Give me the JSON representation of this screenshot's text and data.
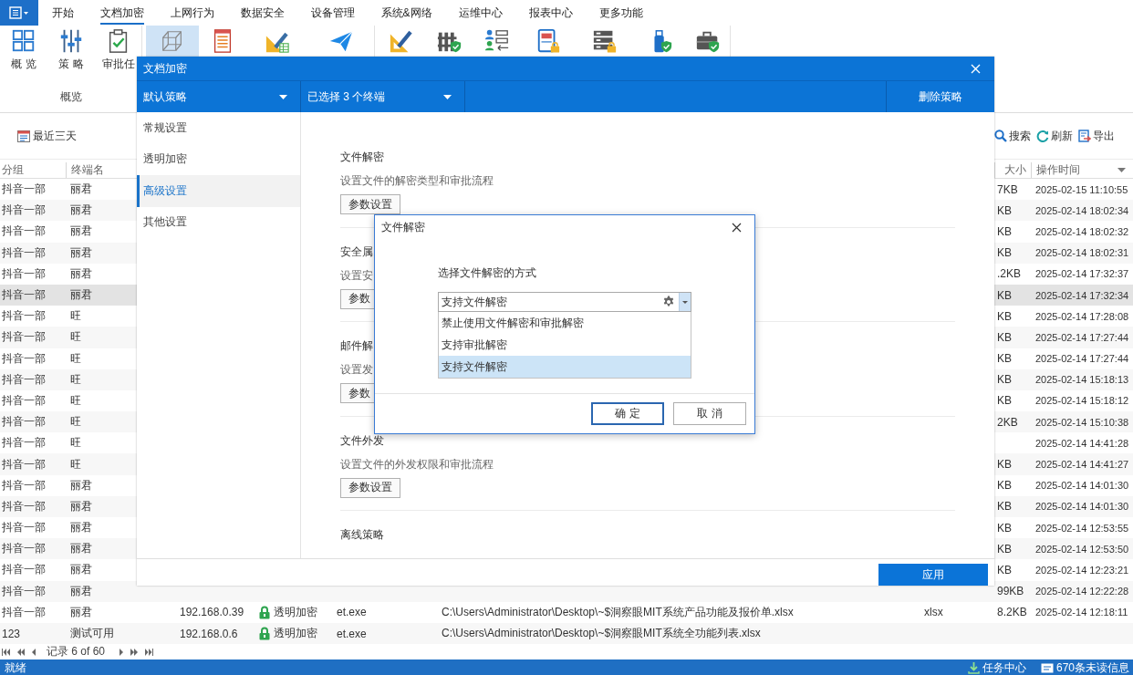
{
  "menu_tabs": [
    {
      "label": "开始",
      "selected": false
    },
    {
      "label": "文档加密",
      "selected": true
    },
    {
      "label": "上网行为",
      "selected": false
    },
    {
      "label": "数据安全",
      "selected": false
    },
    {
      "label": "设备管理",
      "selected": false
    },
    {
      "label": "系统&网络",
      "selected": false
    },
    {
      "label": "运维中心",
      "selected": false
    },
    {
      "label": "报表中心",
      "selected": false
    },
    {
      "label": "更多功能",
      "selected": false
    }
  ],
  "ribbon": {
    "groups": [
      {
        "label": "概览",
        "tools": [
          {
            "label": "概 览",
            "selected": false
          },
          {
            "label": "策 略",
            "selected": false
          },
          {
            "label": "审批任",
            "selected": false
          }
        ]
      },
      {
        "tools": [
          {
            "selected": true
          },
          {
            "selected": false
          },
          {
            "selected": false
          },
          {
            "selected": false
          }
        ]
      },
      {
        "tools": [
          {
            "selected": false
          },
          {
            "selected": false
          },
          {
            "selected": false
          },
          {
            "selected": false
          },
          {
            "selected": false
          },
          {
            "selected": false
          },
          {
            "selected": false
          }
        ]
      }
    ]
  },
  "filter": {
    "label": "最近三天"
  },
  "actions": [
    {
      "label": "搜索"
    },
    {
      "label": "刷新"
    },
    {
      "label": "导出"
    }
  ],
  "table": {
    "header": {
      "group": "分组",
      "terminal": "终端名",
      "size": "大小",
      "time": "操作时间"
    },
    "rows": [
      {
        "group": "抖音一部",
        "terminal": "丽君",
        "size": "7KB",
        "time": "2025-02-15 11:10:55",
        "selected": false
      },
      {
        "group": "抖音一部",
        "terminal": "丽君",
        "size": "KB",
        "time": "2025-02-14 18:02:34",
        "selected": false
      },
      {
        "group": "抖音一部",
        "terminal": "丽君",
        "size": "KB",
        "time": "2025-02-14 18:02:32",
        "selected": false
      },
      {
        "group": "抖音一部",
        "terminal": "丽君",
        "size": "KB",
        "time": "2025-02-14 18:02:31",
        "selected": false
      },
      {
        "group": "抖音一部",
        "terminal": "丽君",
        "size": ".2KB",
        "time": "2025-02-14 17:32:37",
        "selected": false
      },
      {
        "group": "抖音一部",
        "terminal": "丽君",
        "size": "KB",
        "time": "2025-02-14 17:32:34",
        "selected": true
      },
      {
        "group": "抖音一部",
        "terminal": "旺",
        "size": "KB",
        "time": "2025-02-14 17:28:08",
        "selected": false
      },
      {
        "group": "抖音一部",
        "terminal": "旺",
        "size": "KB",
        "time": "2025-02-14 17:27:44",
        "selected": false
      },
      {
        "group": "抖音一部",
        "terminal": "旺",
        "size": "KB",
        "time": "2025-02-14 17:27:44",
        "selected": false
      },
      {
        "group": "抖音一部",
        "terminal": "旺",
        "size": "KB",
        "time": "2025-02-14 15:18:13",
        "selected": false
      },
      {
        "group": "抖音一部",
        "terminal": "旺",
        "size": "KB",
        "time": "2025-02-14 15:18:12",
        "selected": false
      },
      {
        "group": "抖音一部",
        "terminal": "旺",
        "size": "2KB",
        "time": "2025-02-14 15:10:38",
        "selected": false
      },
      {
        "group": "抖音一部",
        "terminal": "旺",
        "time": "2025-02-14 14:41:28",
        "selected": false
      },
      {
        "group": "抖音一部",
        "terminal": "旺",
        "size": "KB",
        "time": "2025-02-14 14:41:27",
        "selected": false
      },
      {
        "group": "抖音一部",
        "terminal": "丽君",
        "size": "KB",
        "time": "2025-02-14 14:01:30",
        "selected": false
      },
      {
        "group": "抖音一部",
        "terminal": "丽君",
        "size": "KB",
        "time": "2025-02-14 14:01:30",
        "selected": false
      },
      {
        "group": "抖音一部",
        "terminal": "丽君",
        "size": "KB",
        "time": "2025-02-14 12:53:55",
        "selected": false
      },
      {
        "group": "抖音一部",
        "terminal": "丽君",
        "size": "KB",
        "time": "2025-02-14 12:53:50",
        "selected": false
      },
      {
        "group": "抖音一部",
        "terminal": "丽君",
        "size": "KB",
        "time": "2025-02-14 12:23:21",
        "selected": false
      },
      {
        "group": "抖音一部",
        "terminal": "丽君",
        "size": "99KB",
        "time": "2025-02-14 12:22:28",
        "selected": false
      },
      {
        "group": "抖音一部",
        "terminal": "丽君",
        "ip": "192.168.0.39",
        "status": "透明加密",
        "process": "et.exe",
        "path": "C:\\Users\\Administrator\\Desktop\\~$洞察眼MIT系统产品功能及报价单.xlsx",
        "type": "xlsx",
        "size": "8.2KB",
        "time": "2025-02-14 12:18:11",
        "selected": false
      },
      {
        "group": "123",
        "terminal": "测试可用",
        "ip": "192.168.0.6",
        "status": "透明加密",
        "process": "et.exe",
        "path": "C:\\Users\\Administrator\\Desktop\\~$洞察眼MIT系统全功能列表.xlsx",
        "selected": false
      }
    ]
  },
  "pager": {
    "text": "记录 6 of 60"
  },
  "status_bar": {
    "text": "就绪",
    "tasks": "任务中心",
    "messages": "670条未读信息"
  },
  "dialog": {
    "title": "文档加密",
    "policy_select": "默认策略",
    "terminal_select": "已选择 3 个终端",
    "delete_button": "删除策略",
    "nav": [
      {
        "label": "常规设置",
        "selected": false
      },
      {
        "label": "透明加密",
        "selected": false
      },
      {
        "label": "高级设置",
        "selected": true
      },
      {
        "label": "其他设置",
        "selected": false
      }
    ],
    "sections": [
      {
        "title": "文件解密",
        "description": "设置文件的解密类型和审批流程",
        "button": "参数设置"
      },
      {
        "title": "安全属",
        "description": "设置安",
        "button": "参数"
      },
      {
        "title": "邮件解",
        "description": "设置发",
        "button": "参数"
      },
      {
        "title": "文件外发",
        "description": "设置文件的外发权限和审批流程",
        "button": "参数设置"
      },
      {
        "title": "离线策略"
      }
    ],
    "apply_button": "应用"
  },
  "inner_dialog": {
    "title": "文件解密",
    "prompt": "选择文件解密的方式",
    "select": {
      "value": "支持文件解密",
      "expanded": true,
      "options": [
        {
          "label": "禁止使用文件解密和审批解密",
          "selected": false
        },
        {
          "label": "支持审批解密",
          "selected": false
        },
        {
          "label": "支持文件解密",
          "selected": true
        }
      ]
    },
    "buttons": [
      {
        "label": "确 定",
        "kind": "primary"
      },
      {
        "label": "取 消",
        "kind": "secondary"
      }
    ]
  }
}
